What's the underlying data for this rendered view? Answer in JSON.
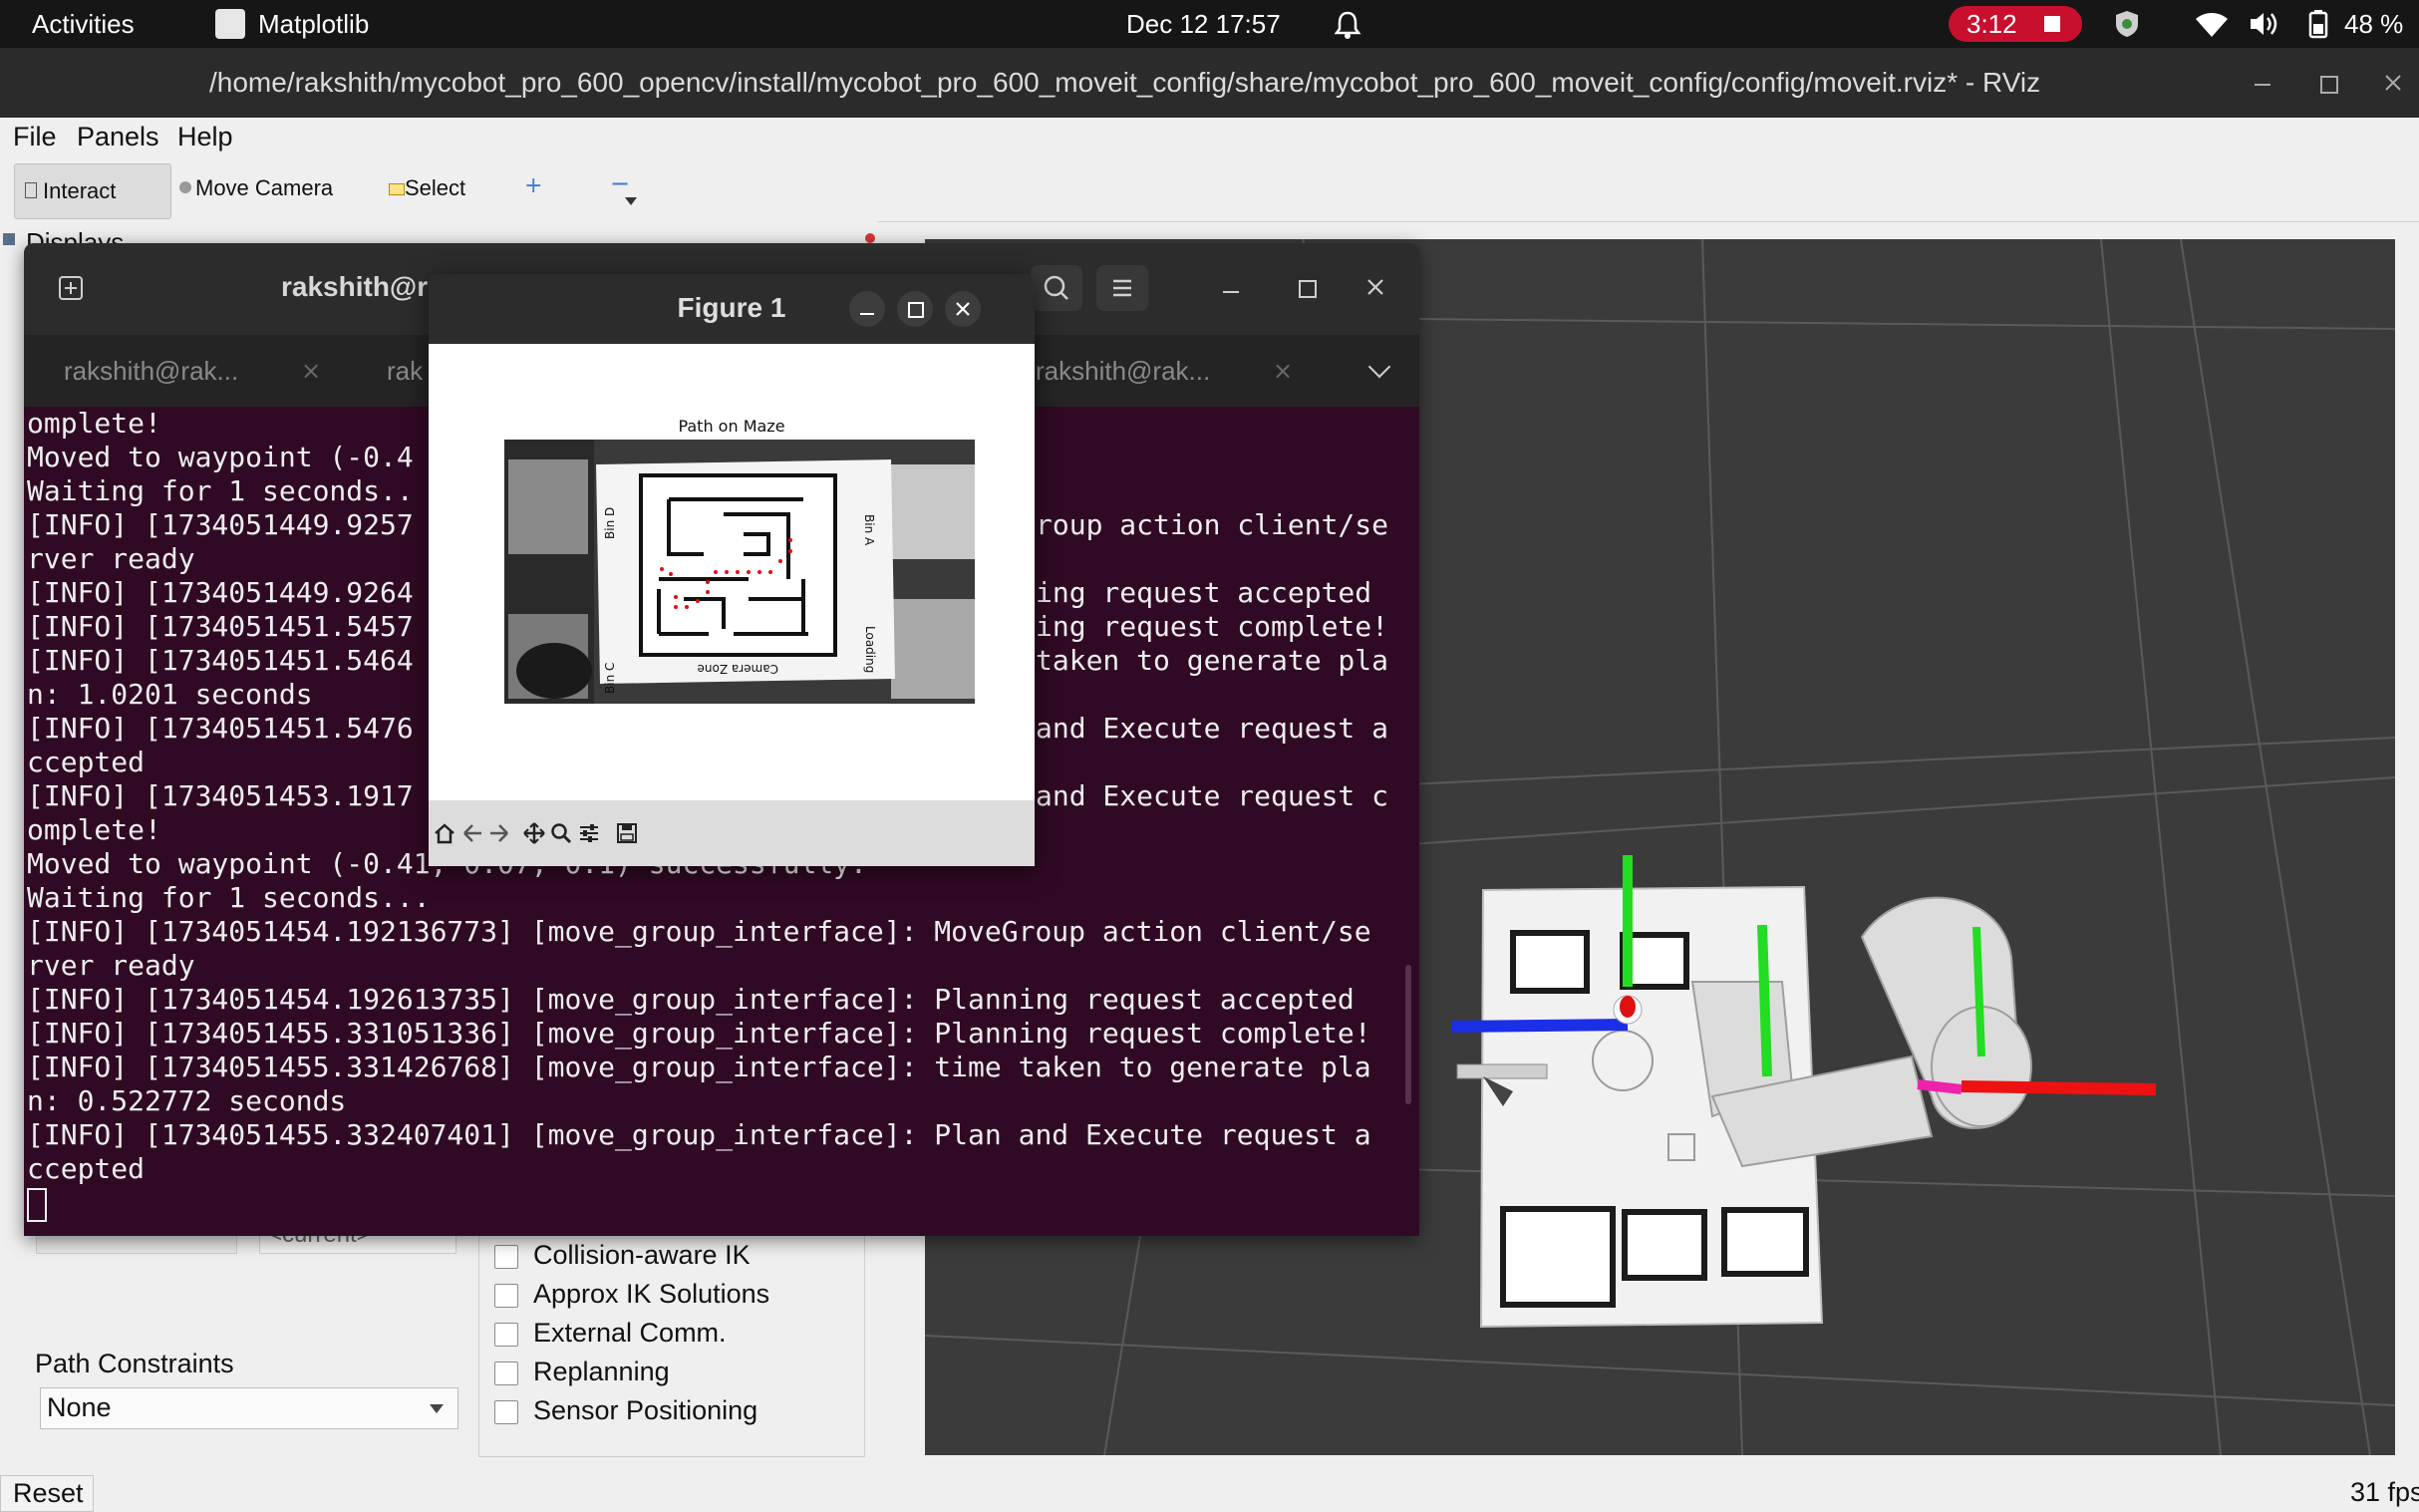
{
  "topbar": {
    "activities": "Activities",
    "app_name": "Matplotlib",
    "datetime": "Dec 12  17:57",
    "record_time": "3:12",
    "battery": "48 %"
  },
  "rviz": {
    "title": "/home/rakshith/mycobot_pro_600_opencv/install/mycobot_pro_600_moveit_config/share/mycobot_pro_600_moveit_config/config/moveit.rviz* - RViz",
    "menu": [
      "File",
      "Panels",
      "Help"
    ],
    "tools": {
      "interact": "Interact",
      "move_camera": "Move Camera",
      "select": "Select"
    },
    "displays_label": "Displays",
    "path_constraints_label": "Path Constraints",
    "path_constraints_value": "None",
    "current_label": "<current>",
    "checkboxes": [
      "Collision-aware IK",
      "Approx IK Solutions",
      "External Comm.",
      "Replanning",
      "Sensor Positioning"
    ],
    "reset_label": "Reset",
    "fps": "31 fps"
  },
  "terminal": {
    "header_title": "rakshith@r",
    "tabs": [
      "rakshith@rak...",
      "rak",
      "rakshith@rak..."
    ],
    "lines_full": [
      "Moved to waypoint (-0.41, 0.07, 0.1) successfully.",
      "Waiting for 1 seconds...",
      "[INFO] [1734051454.192136773] [move_group_interface]: MoveGroup action client/se",
      "rver ready",
      "[INFO] [1734051454.192613735] [move_group_interface]: Planning request accepted",
      "[INFO] [1734051455.331051336] [move_group_interface]: Planning request complete!",
      "[INFO] [1734051455.331426768] [move_group_interface]: time taken to generate pla",
      "n: 0.522772 seconds",
      "[INFO] [1734051455.332407401] [move_group_interface]: Plan and Execute request a",
      "ccepted"
    ],
    "lines_left": [
      "omplete!",
      "Moved to waypoint (-0.4",
      "Waiting for 1 seconds..",
      "[INFO] [1734051449.9257",
      "rver ready",
      "[INFO] [1734051449.9264",
      "[INFO] [1734051451.5457",
      "[INFO] [1734051451.5464",
      "n: 1.0201 seconds",
      "[INFO] [1734051451.5476",
      "ccepted",
      "[INFO] [1734051453.1917",
      "omplete!"
    ],
    "lines_right": [
      "roup action client/se",
      "ing request accepted",
      "ing request complete!",
      "taken to generate pla",
      "and Execute request a",
      "and Execute request c"
    ]
  },
  "figure": {
    "title": "Figure 1",
    "plot_title": "Path on Maze",
    "maze_labels": [
      "Bin D",
      "Bin A",
      "Bin C",
      "Loading",
      "Camera Zone"
    ]
  },
  "colors": {
    "terminal_bg": "#300a24",
    "record_red": "#c8102e",
    "viewport_bg": "#3b3b3b"
  }
}
